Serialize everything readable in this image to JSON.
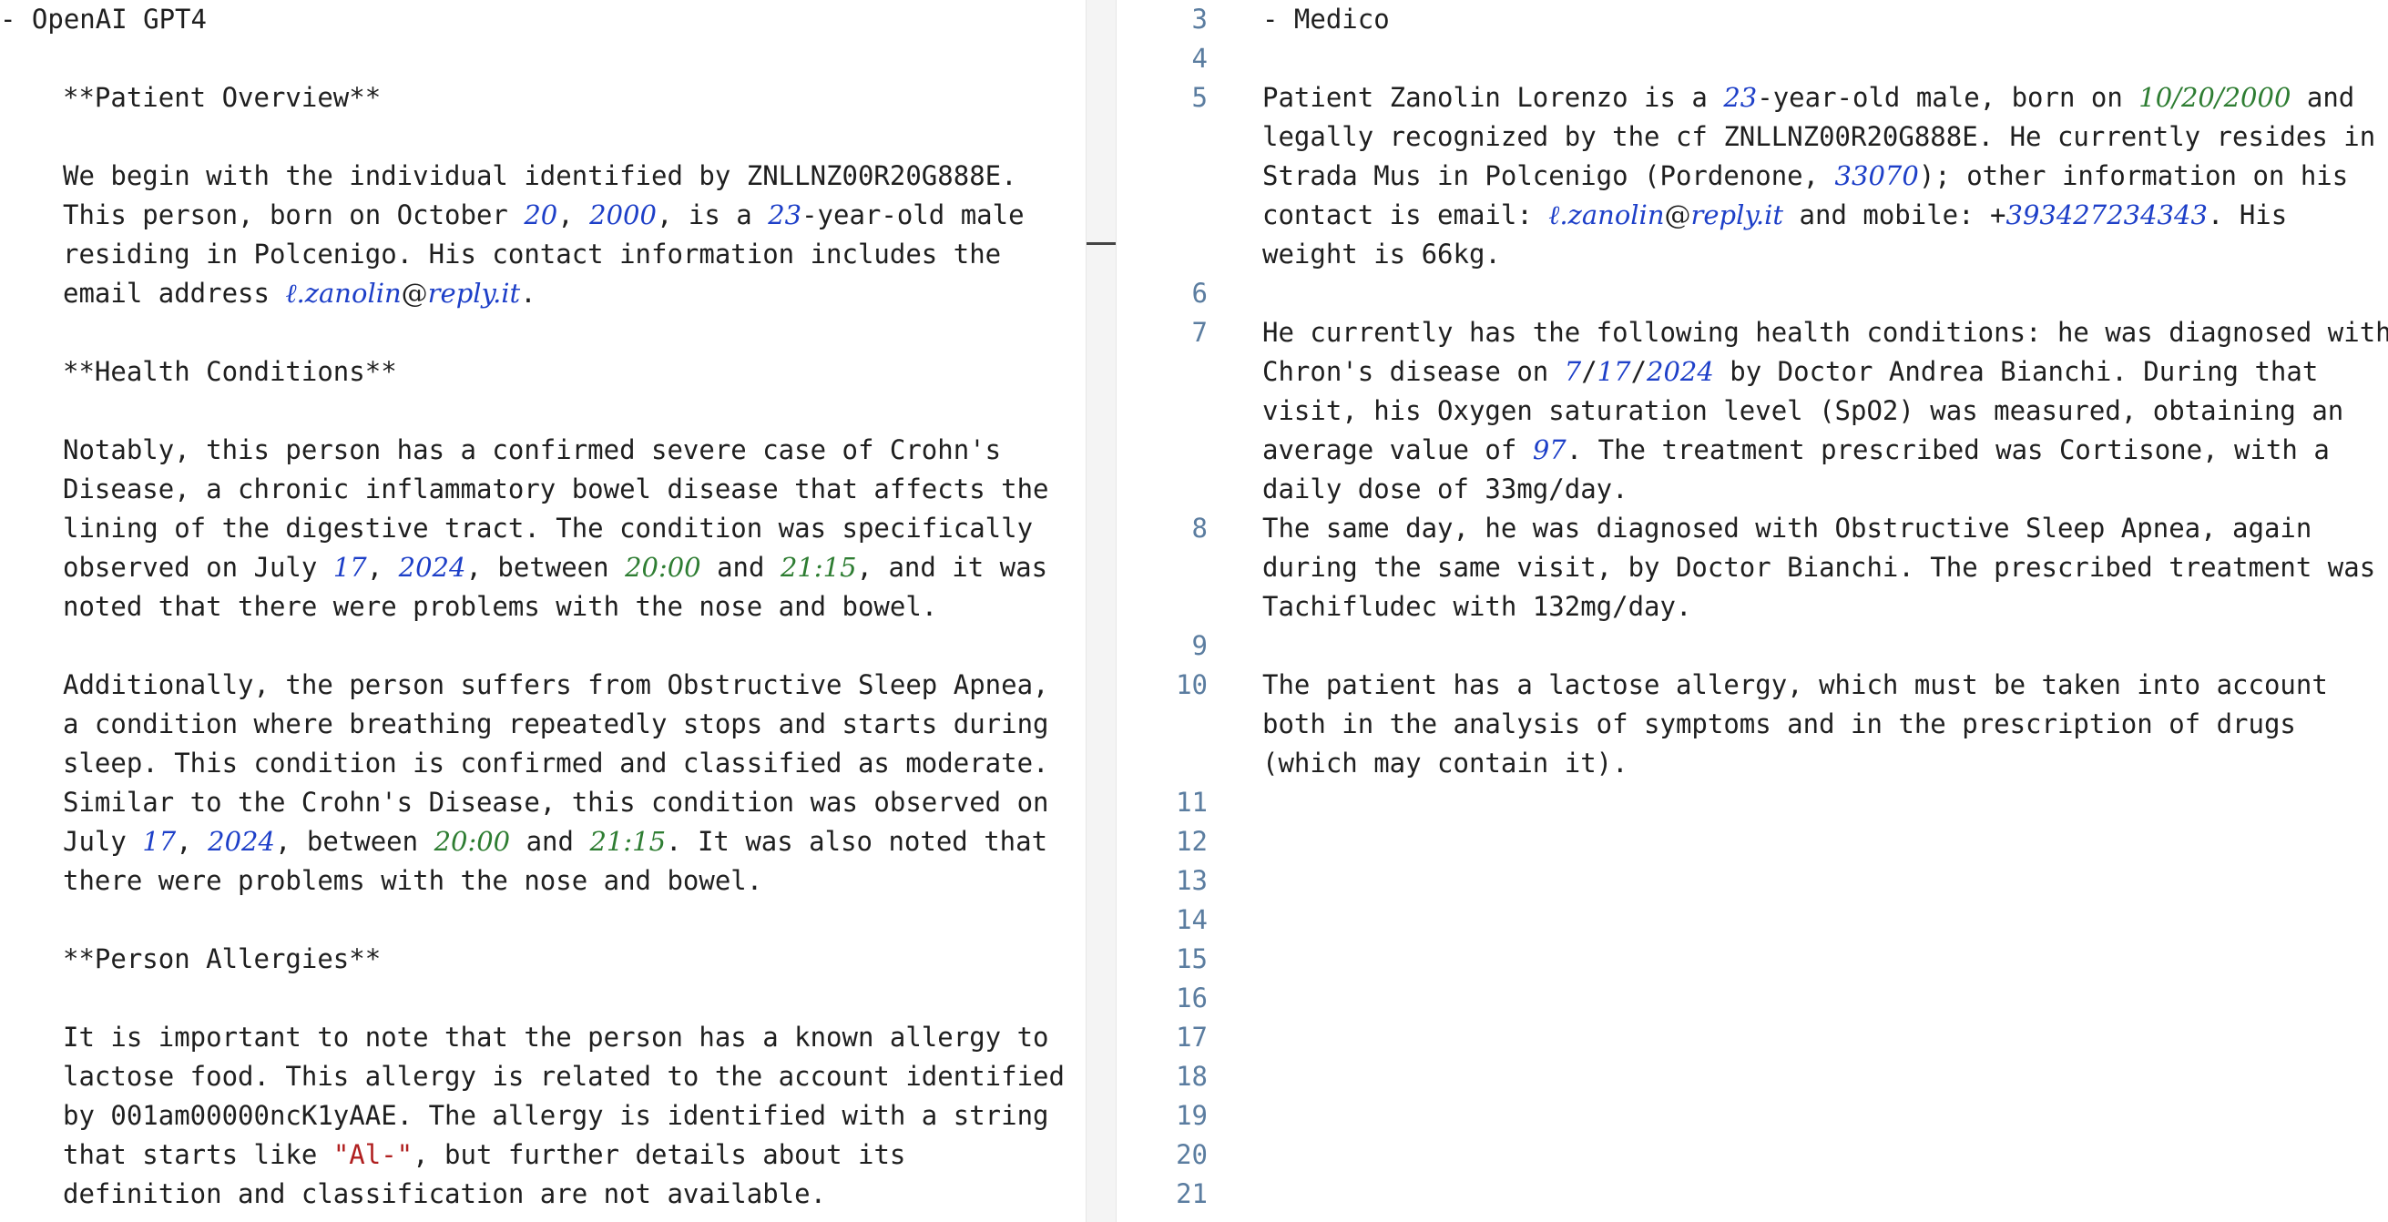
{
  "left": {
    "heading": "- OpenAI GPT4",
    "overview_title": "**Patient Overview**",
    "overview": {
      "l1": "We begin with the individual identified by ZNLLNZ00R20G888E.",
      "l2a": "This person, born on October ",
      "l2_day": "20",
      "l2_comma": ", ",
      "l2_year": "2000",
      "l2b": ", is a ",
      "l2_age": "23",
      "l2c": "-year-old male",
      "l3": "residing in Polcenigo. His contact information includes the",
      "l4a": "email address ",
      "l4_email_user": "ℓ.zanolin",
      "l4_at": "@",
      "l4_email_domain": "reply.it",
      "l4b": "."
    },
    "health_title": "**Health Conditions**",
    "crohn": {
      "l1": "Notably, this person has a confirmed severe case of Crohn's",
      "l2": "Disease, a chronic inflammatory bowel disease that affects the",
      "l3": "lining of the digestive tract. The condition was specifically",
      "l4a": "observed on July ",
      "l4_day": "17",
      "l4_comma": ", ",
      "l4_year": "2024",
      "l4b": ", between ",
      "l4_t1": "20:00",
      "l4c": " and ",
      "l4_t2": "21:15",
      "l4d": ", and it was",
      "l5": "noted that there were problems with the nose and bowel."
    },
    "apnea": {
      "l1": "Additionally, the person suffers from Obstructive Sleep Apnea,",
      "l2": "a condition where breathing repeatedly stops and starts during",
      "l3": "sleep. This condition is confirmed and classified as moderate.",
      "l4": "Similar to the Crohn's Disease, this condition was observed on",
      "l5a": "July ",
      "l5_day": "17",
      "l5_comma": ", ",
      "l5_year": "2024",
      "l5b": ", between ",
      "l5_t1": "20:00",
      "l5c": " and ",
      "l5_t2": "21:15",
      "l5d": ". It was also noted that",
      "l6": "there were problems with the nose and bowel."
    },
    "allergy_title": "**Person Allergies**",
    "allergy": {
      "l1": "It is important to note that the person has a known allergy to",
      "l2": "lactose food. This allergy is related to the account identified",
      "l3": "by 001am00000ncK1yAAE. The allergy is identified with a string",
      "l4a": "that starts like ",
      "l4_str": "\"Al-\"",
      "l4b": ", but further details about its",
      "l5": "definition and classification are not available."
    }
  },
  "right": {
    "line_numbers": [
      "3",
      "4",
      "5",
      "6",
      "7",
      "8",
      "9",
      "10",
      "11",
      "12",
      "13",
      "14",
      "15",
      "16",
      "17",
      "18",
      "19",
      "20",
      "21"
    ],
    "heading": "- Medico",
    "p5": {
      "l1a": "Patient Zanolin Lorenzo is a ",
      "l1_age": "23",
      "l1b": "-year-old male, born on ",
      "l1_date": "10/20/2000",
      "l1c": " and",
      "l2": "legally recognized by the cf ZNLLNZ00R20G888E. He currently resides in",
      "l3a": "Strada Mus in Polcenigo (Pordenone, ",
      "l3_cap": "33070",
      "l3b": "); other information on his",
      "l4a": "contact is email: ",
      "l4_email_user": "ℓ.zanolin",
      "l4_at": "@",
      "l4_email_domain": "reply.it",
      "l4b": " and mobile: +",
      "l4_phone": "393427234343",
      "l4c": ". His",
      "l5": "weight is 66kg."
    },
    "p7": {
      "l1": "He currently has the following health conditions: he was diagnosed with",
      "l2a": "Chron's disease on ",
      "l2_m": "7",
      "l2_s1": "/",
      "l2_d": "17",
      "l2_s2": "/",
      "l2_y": "2024",
      "l2b": " by Doctor Andrea Bianchi. During that",
      "l3": "visit, his Oxygen saturation level (SpO2) was measured, obtaining an",
      "l4a": "average value of ",
      "l4_val": "97",
      "l4b": ". The treatment prescribed was Cortisone, with a",
      "l5": "daily dose of 33mg/day."
    },
    "p8": {
      "l1": "The same day, he was diagnosed with Obstructive Sleep Apnea, again",
      "l2": "during the same visit, by Doctor Bianchi. The prescribed treatment was",
      "l3": "Tachifludec with 132mg/day."
    },
    "p10": {
      "l1": "The patient has a lactose allergy, which must be taken into account",
      "l2": "both in the analysis of symptoms and in the prescription of drugs",
      "l3": "(which may contain it)."
    }
  }
}
